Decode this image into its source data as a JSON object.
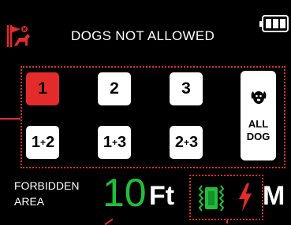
{
  "header": {
    "title": "DOGS NOT ALLOWED",
    "mode_icon": "no-dog-flag-icon",
    "battery_icon": "battery-full-icon"
  },
  "channels": [
    {
      "label": "1",
      "active": true
    },
    {
      "label": "2",
      "active": false
    },
    {
      "label": "3",
      "active": false
    }
  ],
  "combos": [
    {
      "a": "1",
      "b": "2"
    },
    {
      "a": "1",
      "b": "3"
    },
    {
      "a": "2",
      "b": "3"
    }
  ],
  "combo_sep": "+",
  "all_dog": {
    "line1": "ALL",
    "line2": "DOG",
    "icon": "dog-face-icon"
  },
  "forbidden_area": {
    "line1": "FORBIDDEN",
    "line2": "AREA",
    "distance": "10",
    "unit": "Ft"
  },
  "stimulation": {
    "mode_icon": "vibration-icon",
    "shock_icon": "lightning-bolt-icon",
    "level": "M"
  },
  "colors": {
    "accent_red": "#e32b2b",
    "distance_green": "#1fbf3a",
    "background": "#000000"
  }
}
